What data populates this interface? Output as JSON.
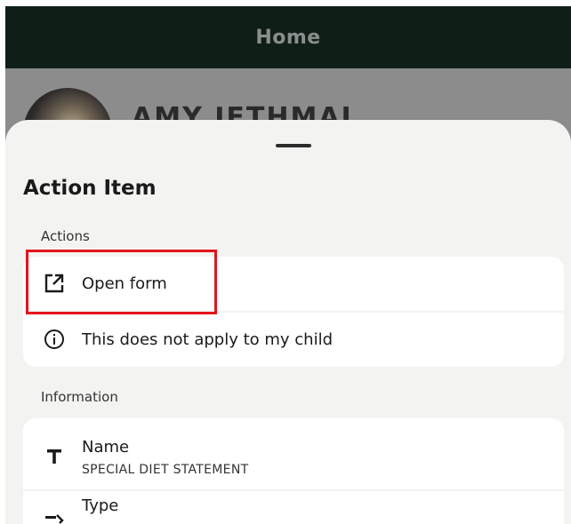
{
  "app_bar": {
    "title": "Home"
  },
  "background": {
    "child_name": "AMY JETHMAI"
  },
  "sheet": {
    "title": "Action Item",
    "actions_label": "Actions",
    "actions": [
      {
        "label": "Open form",
        "icon": "open-in-new-icon"
      },
      {
        "label": "This does not apply to my child",
        "icon": "info-icon"
      }
    ],
    "information_label": "Information",
    "information": [
      {
        "title": "Name",
        "value": "SPECIAL DIET STATEMENT",
        "icon": "text-icon"
      },
      {
        "title": "Type",
        "value": "",
        "icon": "type-icon"
      }
    ]
  },
  "colors": {
    "app_bar_bg": "#0f1f18",
    "sheet_bg": "#f3f3f1",
    "card_bg": "#ffffff",
    "highlight": "#e4141b"
  }
}
